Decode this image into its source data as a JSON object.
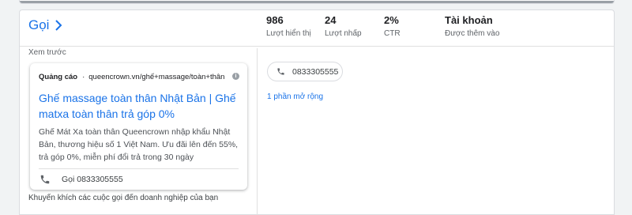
{
  "header": {
    "title": "Gọi",
    "stats": [
      {
        "value": "986",
        "label": "Lượt hiển thị"
      },
      {
        "value": "24",
        "label": "Lượt nhấp"
      },
      {
        "value": "2%",
        "label": "CTR"
      },
      {
        "value": "Tài khoản",
        "label": "Được thêm vào"
      }
    ]
  },
  "preview": {
    "label": "Xem trước",
    "ad": {
      "badge": "Quảng cáo",
      "dot": "·",
      "url": "queencrown.vn/ghế+massage/toàn+thân",
      "headline": "Ghế massage toàn thân Nhật Bản | Ghế matxa toàn thân trả góp 0%",
      "description": "Ghế Mát Xa toàn thân Queencrown nhập khẩu Nhật Bản, thương hiệu số 1 Việt Nam. Ưu đãi lên đến 55%, trả góp 0%, miễn phí đổi trả trong 30 ngày",
      "call_text": "Gọi 0833305555"
    },
    "footnote": "Khuyến khích các cuộc gọi đến doanh nghiệp của bạn"
  },
  "details": {
    "phone": "0833305555",
    "extensions_link": "1 phần mở rộng"
  },
  "colors": {
    "link": "#1a73e8",
    "secondary_text": "#5f6368",
    "border": "#dadce0"
  },
  "icons": {
    "chevron": "chevron-right-icon",
    "phone": "phone-icon",
    "info": "info-icon"
  }
}
